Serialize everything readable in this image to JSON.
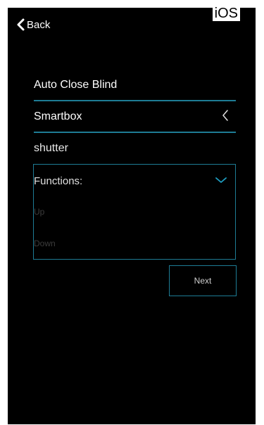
{
  "platform_label": "iOS",
  "nav": {
    "back_label": "Back"
  },
  "form": {
    "name_value": "Auto Close Blind",
    "device_value": "Smartbox",
    "type_text": "shutter",
    "functions_label": "Functions:",
    "function_options": [
      "Up",
      "Down"
    ]
  },
  "actions": {
    "next_label": "Next"
  },
  "colors": {
    "background": "#000000",
    "accent": "#1e7c95",
    "text": "#ffffff"
  }
}
